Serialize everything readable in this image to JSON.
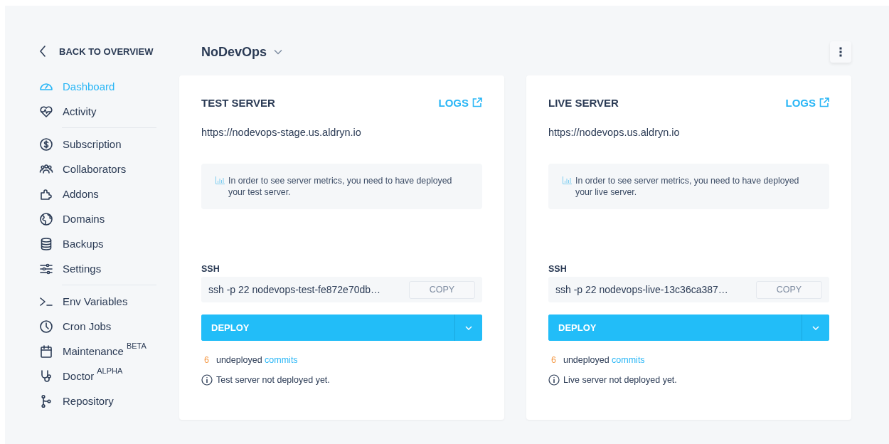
{
  "sidebar": {
    "back_link": "BACK TO OVERVIEW",
    "groups": [
      {
        "items": [
          {
            "label": "Dashboard",
            "selected": true
          },
          {
            "label": "Activity",
            "selected": false
          }
        ]
      },
      {
        "items": [
          {
            "label": "Subscription",
            "selected": false
          },
          {
            "label": "Collaborators",
            "selected": false
          },
          {
            "label": "Addons",
            "selected": false
          },
          {
            "label": "Domains",
            "selected": false
          },
          {
            "label": "Backups",
            "selected": false
          },
          {
            "label": "Settings",
            "selected": false
          }
        ]
      },
      {
        "items": [
          {
            "label": "Env Variables",
            "selected": false
          },
          {
            "label": "Cron Jobs",
            "selected": false
          },
          {
            "label": "Maintenance",
            "badge": "BETA",
            "selected": false
          },
          {
            "label": "Doctor",
            "badge": "ALPHA",
            "selected": false
          },
          {
            "label": "Repository",
            "selected": false
          }
        ]
      }
    ]
  },
  "header": {
    "project": "NoDevOps"
  },
  "servers": [
    {
      "title": "TEST SERVER",
      "logs": "LOGS",
      "url": "https://nodevops-stage.us.aldryn.io",
      "metrics_notice": "In order to see server metrics, you need to have deployed your test server.",
      "ssh_label": "SSH",
      "ssh_command": "ssh -p 22 nodevops-test-fe872e70db…",
      "copy": "COPY",
      "deploy": "DEPLOY",
      "commit_count": "6",
      "commits_text": "undeployed",
      "commits_link": "commits",
      "status": "Test server not deployed yet."
    },
    {
      "title": "LIVE SERVER",
      "logs": "LOGS",
      "url": "https://nodevops.us.aldryn.io",
      "metrics_notice": "In order to see server metrics, you need to have deployed your live server.",
      "ssh_label": "SSH",
      "ssh_command": "ssh -p 22 nodevops-live-13c36ca387…",
      "copy": "COPY",
      "deploy": "DEPLOY",
      "commit_count": "6",
      "commits_text": "undeployed",
      "commits_link": "commits",
      "status": "Live server not deployed yet."
    }
  ]
}
